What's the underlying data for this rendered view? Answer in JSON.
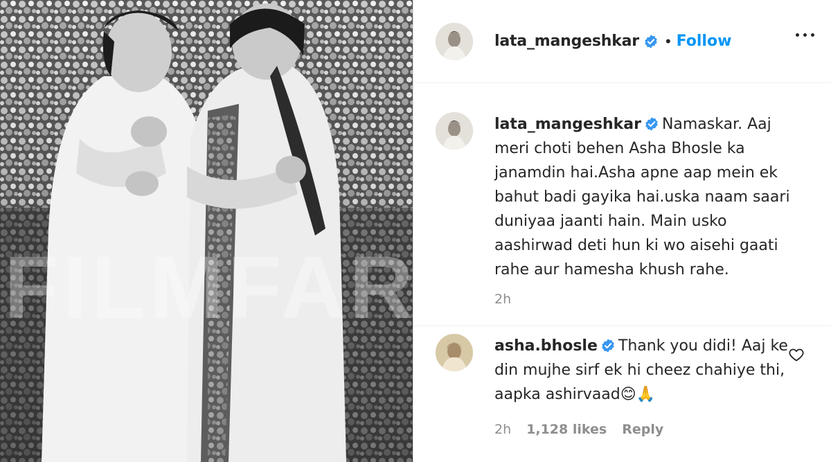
{
  "post": {
    "watermark": "FILMFARE",
    "header": {
      "username": "lata_mangeshkar",
      "separator": "•",
      "follow_label": "Follow"
    },
    "caption": {
      "username": "lata_mangeshkar",
      "text": "Namaskar. Aaj meri choti behen Asha Bhosle ka janamdin hai.Asha apne aap mein ek bahut badi gayika hai.uska naam saari duniyaa jaanti hain. Main usko aashirwad deti hun ki wo aisehi gaati rahe aur hamesha khush rahe.",
      "time": "2h"
    },
    "comment": {
      "username": "asha.bhosle",
      "text": "Thank you didi! Aaj ke din mujhe sirf ek hi cheez chahiye thi, aapka ashirvaad😊🙏",
      "time": "2h",
      "likes": "1,128 likes",
      "reply_label": "Reply"
    }
  },
  "icons": {
    "verified": "verified-badge-icon",
    "more": "more-options-icon",
    "like": "heart-outline-icon"
  },
  "colors": {
    "link_blue": "#0095f6",
    "verified_blue": "#3897f0",
    "text": "#262626",
    "secondary": "#8e8e8e",
    "border": "#dbdbdb"
  }
}
